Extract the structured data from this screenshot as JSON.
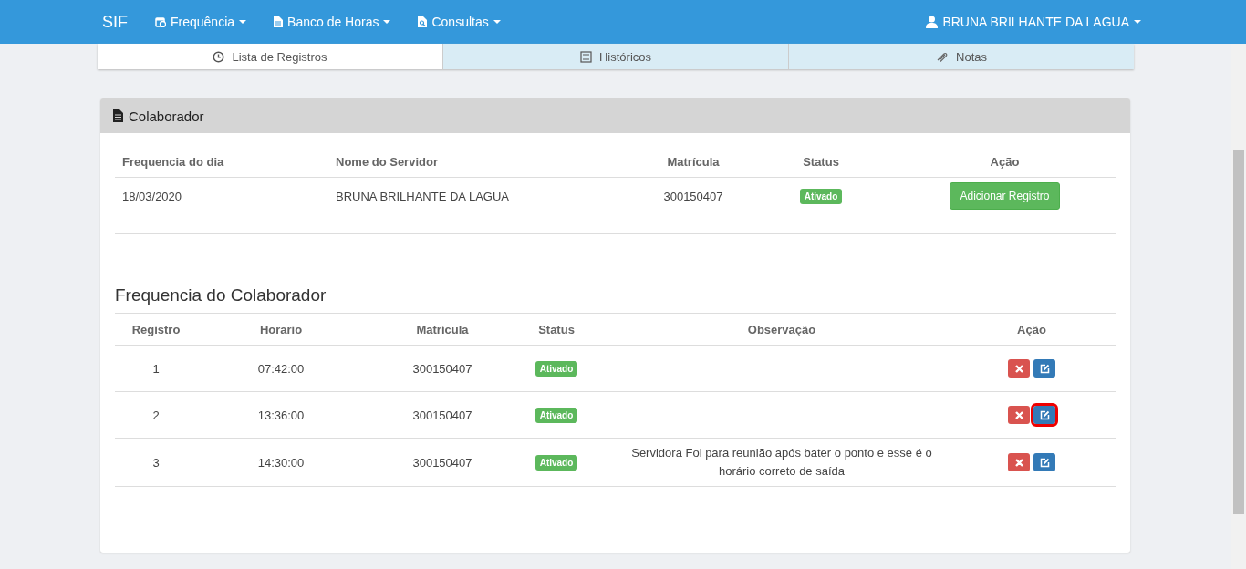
{
  "navbar": {
    "brand": "SIF",
    "menus": [
      {
        "label": "Frequência"
      },
      {
        "label": "Banco de Horas"
      },
      {
        "label": "Consultas"
      }
    ],
    "user": "BRUNA BRILHANTE DA LAGUA"
  },
  "tabs": [
    {
      "label": "Lista de Registros",
      "selected": true
    },
    {
      "label": "Históricos",
      "selected": false
    },
    {
      "label": "Notas",
      "selected": false
    }
  ],
  "panel": {
    "title": "Colaborador",
    "summary": {
      "columns": [
        "Frequencia do dia",
        "Nome do Servidor",
        "Matrícula",
        "Status",
        "Ação"
      ],
      "rows": [
        {
          "date": "18/03/2020",
          "name": "BRUNA BRILHANTE DA LAGUA",
          "matricula": "300150407",
          "status": "Ativado",
          "action": "Adicionar Registro"
        }
      ]
    },
    "section_title": "Frequencia do Colaborador",
    "records": {
      "columns": [
        "Registro",
        "Horario",
        "Matrícula",
        "Status",
        "Observação",
        "Ação"
      ],
      "rows": [
        {
          "registro": "1",
          "horario": "07:42:00",
          "matricula": "300150407",
          "status": "Ativado",
          "observacao": "",
          "edit_highlighted": false
        },
        {
          "registro": "2",
          "horario": "13:36:00",
          "matricula": "300150407",
          "status": "Ativado",
          "observacao": "",
          "edit_highlighted": true
        },
        {
          "registro": "3",
          "horario": "14:30:00",
          "matricula": "300150407",
          "status": "Ativado",
          "observacao": "Servidora Foi para reunião após bater o ponto e esse é o horário correto de saída",
          "edit_highlighted": false
        }
      ]
    }
  }
}
